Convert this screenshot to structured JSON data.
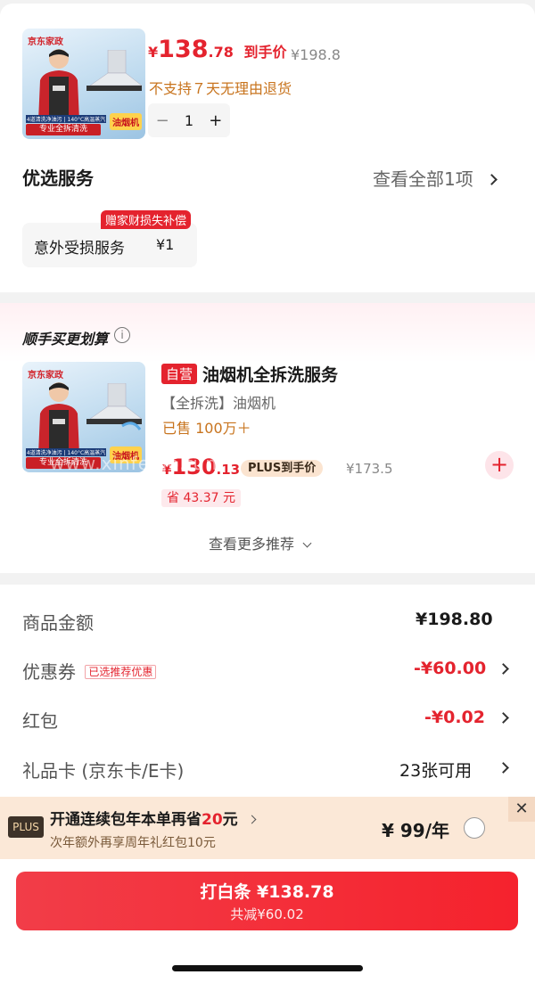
{
  "product": {
    "image_brand": "京东家政",
    "image_strip": "专业全拆清洗",
    "image_tiny": "4道清洗净油污 | 140°C高温蒸汽",
    "image_tag": "油烟机",
    "currency": "¥",
    "price_int": "138",
    "price_dec": ".78",
    "price_note": "到手价",
    "orig_price": "¥198.8",
    "return_note": "不支持７天无理由退货",
    "qty": "1",
    "minus": "−",
    "plus": "+"
  },
  "service": {
    "title": "优选服务",
    "view_all": "查看全部1项",
    "badge": "赠家财损失补偿",
    "item_name": "意外受损服务",
    "item_price": "¥1"
  },
  "bundle": {
    "title": "顺手买更划算",
    "info": "i",
    "self_tag": "自营",
    "name": "油烟机全拆洗服务",
    "sub": "【全拆洗】油烟机",
    "sold": "已售 100万＋",
    "currency": "¥",
    "price_int": "130",
    "price_dec": ".13",
    "plus_price": "PLUS到手价",
    "orig_price": "¥173.5",
    "save": "省 43.37 元",
    "add": "+",
    "more": "查看更多推荐",
    "watermark": "www.xinfeigo.fun"
  },
  "summary": {
    "goods_label": "商品金额",
    "goods_value": "¥198.80",
    "coupon_label": "优惠券",
    "coupon_tag": "已选推荐优惠",
    "coupon_value": "-¥60.00",
    "redpack_label": "红包",
    "redpack_value": "-¥0.02",
    "giftcard_label": "礼品卡 (京东卡/E卡)",
    "giftcard_value": "23张可用"
  },
  "plus_bar": {
    "logo": "PLUS",
    "title_pre": "开通连续包年本单再省",
    "title_num": "20",
    "title_post": "元",
    "sub": "次年额外再享周年礼红包10元",
    "price": "¥ 99/年",
    "close": "✕"
  },
  "pay": {
    "label": "打白条 ¥138.78",
    "sub": "共减¥60.02"
  },
  "colors": {
    "accent": "#e4232e",
    "plus_bg": "#fbe8d7"
  }
}
